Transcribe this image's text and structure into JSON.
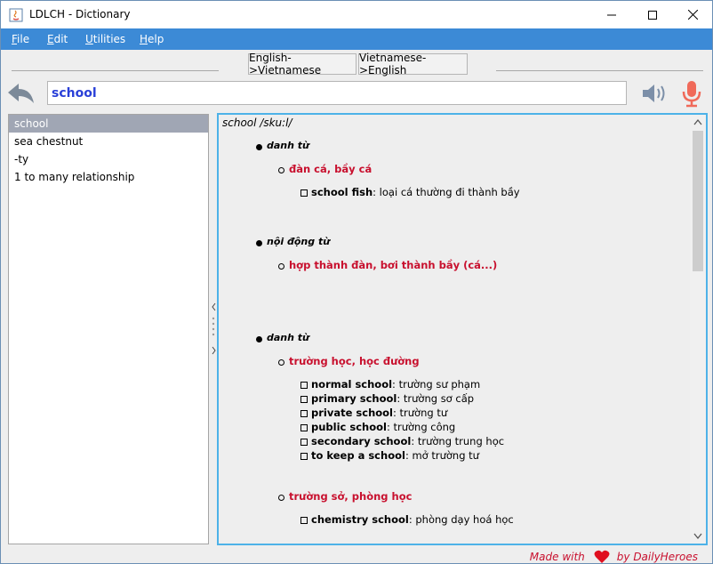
{
  "window": {
    "title": "LDLCH - Dictionary"
  },
  "menu": [
    "File",
    "Edit",
    "Utilities",
    "Help"
  ],
  "direction": {
    "en_vi": "English->Vietnamese",
    "vi_en": "Vietnamese->English"
  },
  "search": {
    "value": "school"
  },
  "words": [
    "school",
    "sea chestnut",
    "-ty",
    "1 to many relationship"
  ],
  "entry": {
    "headword_line": "school /sku:l/",
    "pos1": "danh từ",
    "m1": "đàn cá, bầy cá",
    "m1_ex1_term": "school fish",
    "m1_ex1_def": ": loại cá thường đi thành bầy",
    "pos2": "nội động từ",
    "m2": "hợp thành đàn, bơi thành bầy (cá...)",
    "pos3": "danh từ",
    "m3": "trường học, học đường",
    "m3_ex": [
      {
        "term": "normal school",
        "def": ": trường sư phạm"
      },
      {
        "term": "primary school",
        "def": ": trường sơ cấp"
      },
      {
        "term": "private school",
        "def": ": trường tư"
      },
      {
        "term": "public school",
        "def": ": trường công"
      },
      {
        "term": "secondary school",
        "def": ": trường trung học"
      },
      {
        "term": "to keep a school",
        "def": ": mở trường tư"
      }
    ],
    "m4": "trường sở, phòng học",
    "m4_ex1_term": "chemistry school",
    "m4_ex1_def": ": phòng dạy hoá học"
  },
  "footer": {
    "made_with": "Made with",
    "by": "by DailyHeroes"
  },
  "colors": {
    "menubar": "#3c8ad6",
    "meaning": "#c8102e",
    "search_text": "#2a40d8",
    "focus_border": "#4db2e8"
  }
}
